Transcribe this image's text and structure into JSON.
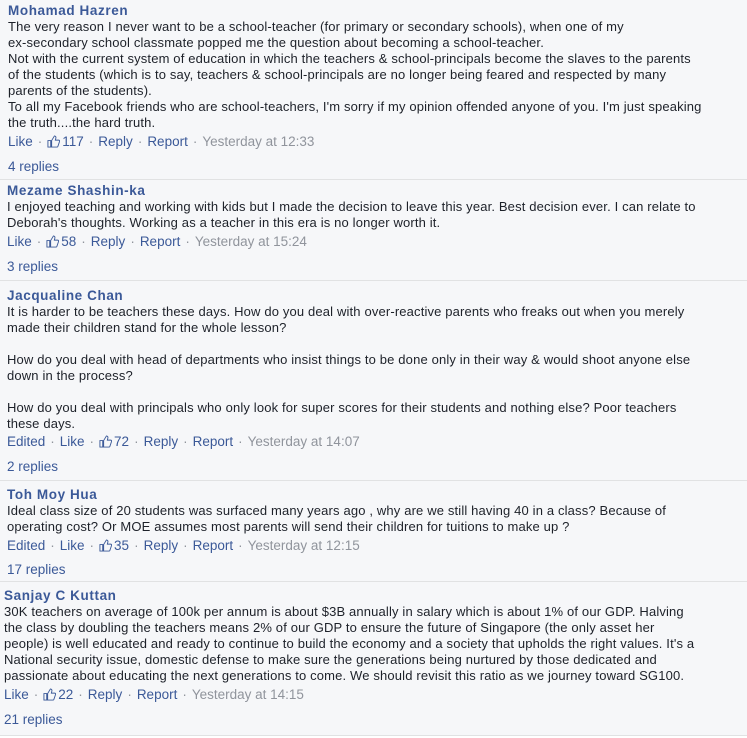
{
  "accent": "#3b5998",
  "muted": "#90949c",
  "comments": [
    {
      "author": "Mohamad Hazren",
      "lines": [
        "The very reason I never want to be a school-teacher (for primary or secondary schools), when one of my",
        "ex-secondary school classmate popped me the question about becoming a school-teacher.",
        "Not with the current system of education in which the teachers & school-principals become the slaves to the parents",
        "of the students (which is to say, teachers & school-principals are no longer being feared and respected by many",
        "parents of the students).",
        "To all my Facebook friends who are school-teachers, I'm sorry if my opinion offended anyone of you. I'm just speaking",
        "the truth....the hard truth."
      ],
      "like_label": "Like",
      "likes": "117",
      "reply_label": "Reply",
      "report_label": "Report",
      "timestamp": "Yesterday at 12:33",
      "replies": "4 replies"
    },
    {
      "author": "Mezame Shashin-ka",
      "lines": [
        "I enjoyed teaching and working with kids but I made the decision to leave this year. Best decision ever. I can relate to",
        "Deborah's thoughts. Working as a teacher in this era is no longer worth it."
      ],
      "like_label": "Like",
      "likes": "58",
      "reply_label": "Reply",
      "report_label": "Report",
      "timestamp": "Yesterday at 15:24",
      "replies": "3 replies"
    },
    {
      "author": "Jacqualine Chan",
      "lines": [
        "It is harder to be teachers these days. How do you deal with over-reactive parents who freaks out when you merely",
        "made their children stand for the whole lesson?",
        "",
        "How do you deal with head of departments who insist things to be done only in their way & would shoot anyone else",
        "down in the process?",
        "",
        "How do you deal with principals who only look for super scores for their students and nothing else? Poor teachers",
        "these days."
      ],
      "edited_label": "Edited",
      "like_label": "Like",
      "likes": "72",
      "reply_label": "Reply",
      "report_label": "Report",
      "timestamp": "Yesterday at 14:07",
      "replies": "2 replies"
    },
    {
      "author": "Toh Moy Hua",
      "lines": [
        "Ideal class size of 20 students was surfaced many years ago , why are we still having 40 in a class? Because of",
        "operating cost? Or MOE assumes most parents will send their children for tuitions to make up ?"
      ],
      "edited_label": "Edited",
      "like_label": "Like",
      "likes": "35",
      "reply_label": "Reply",
      "report_label": "Report",
      "timestamp": "Yesterday at 12:15",
      "replies": "17 replies"
    },
    {
      "author": "Sanjay C Kuttan",
      "lines": [
        "30K teachers on average of 100k per annum is about $3B annually in salary which is about 1% of our GDP. Halving",
        "the class by doubling the teachers means 2% of our GDP to ensure the future of Singapore (the only asset her",
        "people) is well educated and ready to continue to build the economy and a society that upholds the right values. It's a",
        "National security issue, domestic defense to make sure the generations being nurtured by those dedicated and",
        "passionate about educating the next generations to come. We should revisit this ratio as we journey toward SG100."
      ],
      "like_label": "Like",
      "likes": "22",
      "reply_label": "Reply",
      "report_label": "Report",
      "timestamp": "Yesterday at 14:15",
      "replies": "21 replies"
    }
  ]
}
